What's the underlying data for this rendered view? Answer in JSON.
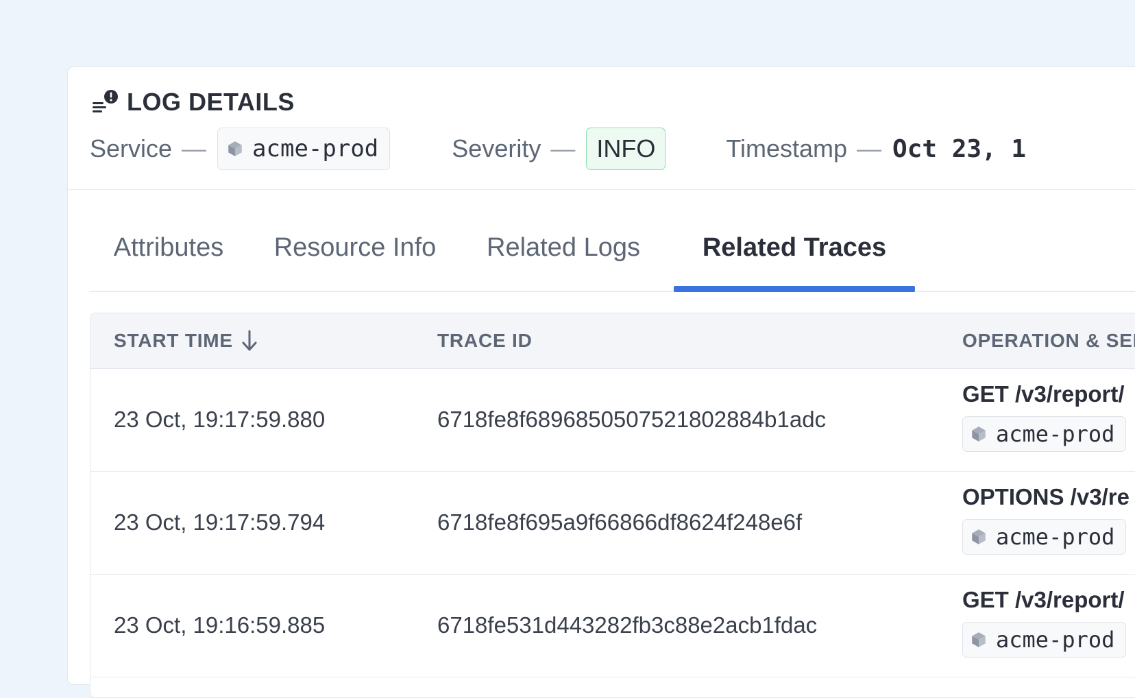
{
  "header": {
    "title": "LOG DETAILS",
    "service_label": "Service",
    "service_value": "acme-prod",
    "severity_label": "Severity",
    "severity_value": "INFO",
    "timestamp_label": "Timestamp",
    "timestamp_value": "Oct 23, 1",
    "dash": "—"
  },
  "tabs": [
    {
      "label": "Attributes",
      "active": false
    },
    {
      "label": "Resource Info",
      "active": false
    },
    {
      "label": "Related Logs",
      "active": false
    },
    {
      "label": "Related Traces",
      "active": true
    }
  ],
  "table": {
    "columns": [
      "START TIME",
      "TRACE ID",
      "OPERATION & SER"
    ],
    "sort": "descending",
    "rows": [
      {
        "start_time": "23 Oct, 19:17:59.880",
        "trace_id": "6718fe8f68968505075218028 84b1adc",
        "operation": "GET /v3/report/",
        "service": "acme-prod"
      },
      {
        "start_time": "23 Oct, 19:17:59.794",
        "trace_id": "6718fe8f695a9f66866df8624f248e6f",
        "operation": "OPTIONS /v3/re",
        "service": "acme-prod"
      },
      {
        "start_time": "23 Oct, 19:16:59.885",
        "trace_id": "6718fe531d443282fb3c88e2acb1fdac",
        "operation": "GET /v3/report/",
        "service": "acme-prod"
      }
    ]
  },
  "colors": {
    "accent": "#3a73e0",
    "severity_info_bg": "#ecfaf2",
    "severity_info_border": "#8ddfb0"
  },
  "icons": {
    "title": "log-alert-icon",
    "service": "cube-icon",
    "sort": "arrow-down-icon"
  }
}
